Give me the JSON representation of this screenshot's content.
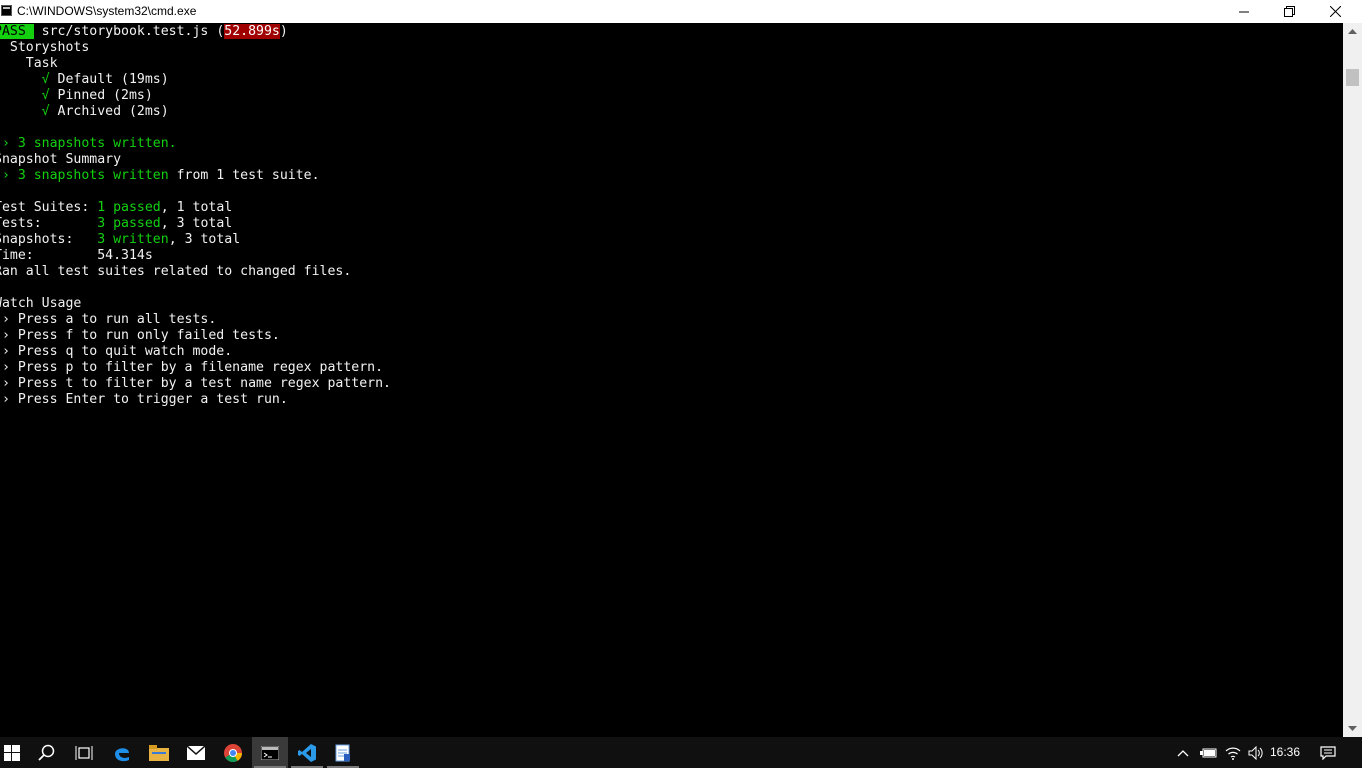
{
  "window": {
    "title": "C:\\WINDOWS\\system32\\cmd.exe",
    "controls": [
      "minimize",
      "maximize",
      "close"
    ]
  },
  "console": {
    "lines": [
      [
        {
          "t": "PASS ",
          "c": "pass"
        },
        {
          "t": " src/storybook.test.js (",
          "c": "white"
        },
        {
          "t": "52.899s",
          "c": "time"
        },
        {
          "t": ")",
          "c": "white"
        }
      ],
      [
        {
          "t": "  Storyshots",
          "c": "white"
        }
      ],
      [
        {
          "t": "    Task",
          "c": "white"
        }
      ],
      [
        {
          "t": "      √ ",
          "c": "green"
        },
        {
          "t": "Default (19ms)",
          "c": "white"
        }
      ],
      [
        {
          "t": "      √ ",
          "c": "green"
        },
        {
          "t": "Pinned (2ms)",
          "c": "white"
        }
      ],
      [
        {
          "t": "      √ ",
          "c": "green"
        },
        {
          "t": "Archived (2ms)",
          "c": "white"
        }
      ],
      [
        {
          "t": "",
          "c": "white"
        }
      ],
      [
        {
          "t": " › 3 snapshots written.",
          "c": "green"
        }
      ],
      [
        {
          "t": "Snapshot Summary",
          "c": "bold"
        }
      ],
      [
        {
          "t": " › 3 snapshots written",
          "c": "green"
        },
        {
          "t": " from 1 test suite.",
          "c": "white"
        }
      ],
      [
        {
          "t": "",
          "c": "white"
        }
      ],
      [
        {
          "t": "Test Suites: ",
          "c": "bold"
        },
        {
          "t": "1 passed",
          "c": "green"
        },
        {
          "t": ", 1 total",
          "c": "white"
        }
      ],
      [
        {
          "t": "Tests:       ",
          "c": "bold"
        },
        {
          "t": "3 passed",
          "c": "green"
        },
        {
          "t": ", 3 total",
          "c": "white"
        }
      ],
      [
        {
          "t": "Snapshots:   ",
          "c": "bold"
        },
        {
          "t": "3 written",
          "c": "green"
        },
        {
          "t": ", 3 total",
          "c": "white"
        }
      ],
      [
        {
          "t": "Time:        ",
          "c": "bold"
        },
        {
          "t": "54.314s",
          "c": "white"
        }
      ],
      [
        {
          "t": "Ran all test suites related to changed files.",
          "c": "white"
        }
      ],
      [
        {
          "t": "",
          "c": "white"
        }
      ],
      [
        {
          "t": "Watch Usage",
          "c": "bold"
        }
      ],
      [
        {
          "t": " › Press a to run all tests.",
          "c": "white"
        }
      ],
      [
        {
          "t": " › Press f to run only failed tests.",
          "c": "white"
        }
      ],
      [
        {
          "t": " › Press q to quit watch mode.",
          "c": "white"
        }
      ],
      [
        {
          "t": " › Press p to filter by a filename regex pattern.",
          "c": "white"
        }
      ],
      [
        {
          "t": " › Press t to filter by a test name regex pattern.",
          "c": "white"
        }
      ],
      [
        {
          "t": " › Press Enter to trigger a test run.",
          "c": "white"
        }
      ]
    ]
  },
  "taskbar": {
    "apps": [
      "start-icon",
      "search-icon",
      "task-view-icon",
      "edge-icon",
      "file-explorer-icon",
      "mail-icon",
      "chrome-icon",
      "cmd-icon",
      "vscode-icon",
      "notepad-icon"
    ],
    "active_app": "cmd-icon",
    "tray": [
      "show-hidden-icons-icon",
      "battery-icon",
      "wifi-icon",
      "volume-icon"
    ],
    "clock": "16:36",
    "notifications": "action-center-icon"
  },
  "colors": {
    "console_bg": "#000000",
    "console_text": "#c0c0c0",
    "green": "#13d10f",
    "time_badge": "#a00000",
    "taskbar_bg": "#101010"
  }
}
